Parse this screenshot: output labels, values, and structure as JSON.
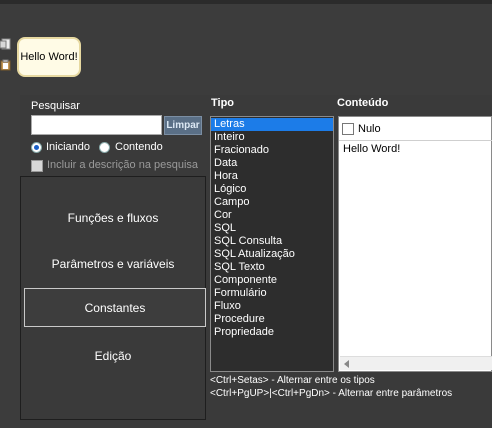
{
  "node": {
    "label": "Hello Word!"
  },
  "search": {
    "label": "Pesquisar",
    "value": "",
    "clear_label": "Limpar"
  },
  "options": {
    "radio_starting": "Iniciando",
    "radio_containing": "Contendo",
    "include_description": "Incluir a descrição na pesquisa"
  },
  "menu": {
    "items": [
      {
        "label": "Funções e fluxos"
      },
      {
        "label": "Parâmetros e variáveis"
      },
      {
        "label": "Constantes"
      },
      {
        "label": "Edição"
      }
    ]
  },
  "type_panel": {
    "header": "Tipo",
    "items": [
      "Letras",
      "Inteiro",
      "Fracionado",
      "Data",
      "Hora",
      "Lógico",
      "Campo",
      "Cor",
      "SQL",
      "SQL Consulta",
      "SQL Atualização",
      "SQL Texto",
      "Componente",
      "Formulário",
      "Fluxo",
      "Procedure",
      "Propriedade"
    ]
  },
  "content_panel": {
    "header": "Conteúdo",
    "null_label": "Nulo",
    "text": "Hello Word!"
  },
  "hints": {
    "line1": "<Ctrl+Setas> - Alternar entre os tipos",
    "line2": "<Ctrl+PgUP>|<Ctrl+PgDn> - Alternar entre parâmetros"
  },
  "colors": {
    "selection": "#1c7ce8",
    "background": "#3a3a3a",
    "node_fill": "#fffbe6"
  }
}
